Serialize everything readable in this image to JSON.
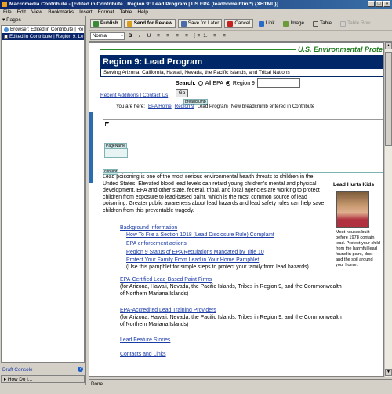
{
  "window": {
    "title": "Macromedia Contribute - [Edited in Contribute | Region 9: Lead Program | US EPA (leadhome.html*) {XHTML}]"
  },
  "menu": [
    "File",
    "Edit",
    "View",
    "Bookmarks",
    "Insert",
    "Format",
    "Table",
    "Help"
  ],
  "sidebar": {
    "pages_label": "Pages",
    "items": [
      "Browser: Edited in Contribute | Re",
      "Edited in Contribute | Region 9: Le"
    ],
    "draft_console": "Draft Console",
    "how_do_i": "How Do I..."
  },
  "toolbar": {
    "publish": "Publish",
    "send_review": "Send for Review",
    "save_later": "Save for Later",
    "cancel": "Cancel",
    "link": "Link",
    "image": "Image",
    "table": "Table",
    "table_row": "Table Row"
  },
  "format": {
    "style": "Normal",
    "buttons": [
      "B",
      "I",
      "U",
      "≡",
      "≡",
      "≡",
      "≡",
      "⋮≡",
      "1.",
      "≡",
      "≡"
    ]
  },
  "page": {
    "agency": "U.S. Environmental Prote",
    "banner": "Region 9: Lead Program",
    "subbanner": "Serving Arizona, California, Hawaii, Nevada, the Pacific Islands, and Tribal Nations",
    "search_label": "Search:",
    "search_all": "All EPA",
    "search_region": "Region 9",
    "go": "Go",
    "recent_additions": "Recent Additions",
    "contact_us": "Contact Us",
    "bc_tag": "breadcrumb",
    "you_are_here": "You are here:",
    "epa_home": "EPA Home",
    "region9": "Region 9",
    "lead_program": "Lead Program",
    "bc_note": "New breadcrumb entered in Contribute",
    "pagename_tag": "PageName",
    "content_tag": "content",
    "intro": "Lead poisoning is one of the most serious environmental health threats to children in the United States. Elevated blood lead levels can retard young children's mental and physical development. EPA and other state, federal, tribal, and local agencies are working to protect children from exposure to lead-based paint, which is the most common source of lead poisoning. Greater public awareness about lead hazards and lead safety rules can help save children from this preventable tragedy.",
    "aside_title": "Lead Hurts Kids",
    "aside_text": "Most houses built before 1978 contain lead. Protect your child from the harmful lead found in paint, dust and the soil around your home.",
    "background": "Background Information",
    "bg_links": [
      "How To File a Section 1018 (Lead Disclosure Rule) Complaint",
      "EPA enforcement actions",
      "Region 9 Status of EPA Regulations Mandated by Title 10",
      "Protect Your Family From Lead in Your Home Pamphlet"
    ],
    "pamphlet_note": "(Use this pamphlet for simple steps to protect your family from lead hazards)",
    "firms": "EPA-Certified Lead-Based Paint Firms",
    "firms_note": "(for Arizona, Hawaii, Nevada, the Pacific Islands, Tribes in Region 9, and the Commonwealth of Northern Mariana Islands)",
    "training": "EPA-Accredited Lead Training Providers",
    "training_note": "(for Arizona, Hawaii, Nevada, the Pacific Islands, Tribes in Region 9, and the Commonwealth of Northern Mariana Islands)",
    "feature": "Lead Feature Stories",
    "contacts": "Contacts and Links"
  },
  "status": "Done",
  "colors": {
    "banner": "#002868",
    "agency": "#1a7a1a",
    "link": "#1a3aa6"
  }
}
